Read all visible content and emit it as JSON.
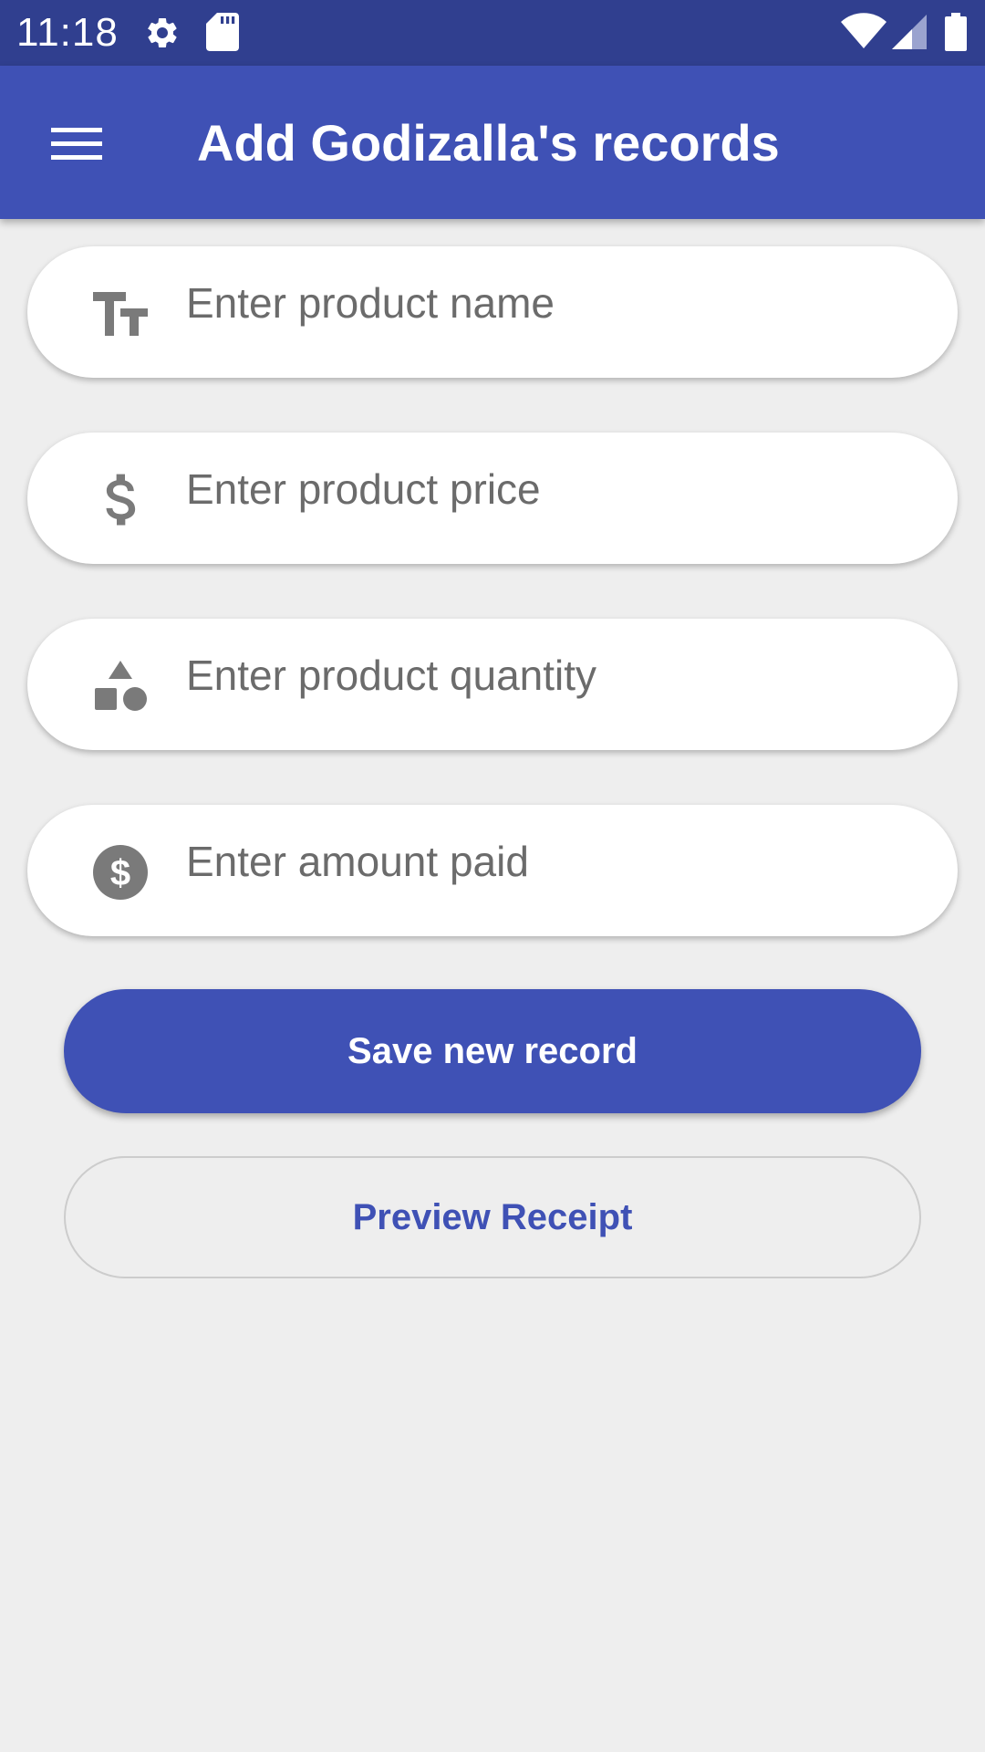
{
  "status_bar": {
    "time": "11:18",
    "left_icons": [
      "settings-icon",
      "sd-card-icon"
    ],
    "right_icons": [
      "wifi-icon",
      "cell-signal-icon",
      "battery-icon"
    ]
  },
  "app_bar": {
    "title": "Add Godizalla's records",
    "menu_icon": "menu-icon"
  },
  "form": {
    "fields": [
      {
        "icon": "text-format-icon",
        "placeholder": "Enter product name",
        "value": ""
      },
      {
        "icon": "dollar-icon",
        "placeholder": "Enter product price",
        "value": ""
      },
      {
        "icon": "shapes-icon",
        "placeholder": "Enter product quantity",
        "value": ""
      },
      {
        "icon": "paid-circle-icon",
        "placeholder": "Enter amount paid",
        "value": ""
      }
    ],
    "save_label": "Save new record",
    "preview_label": "Preview Receipt"
  },
  "colors": {
    "status_bar": "#303f8f",
    "primary": "#3f51b5",
    "background": "#eeeeee",
    "icon_gray": "#7a7a7a"
  }
}
